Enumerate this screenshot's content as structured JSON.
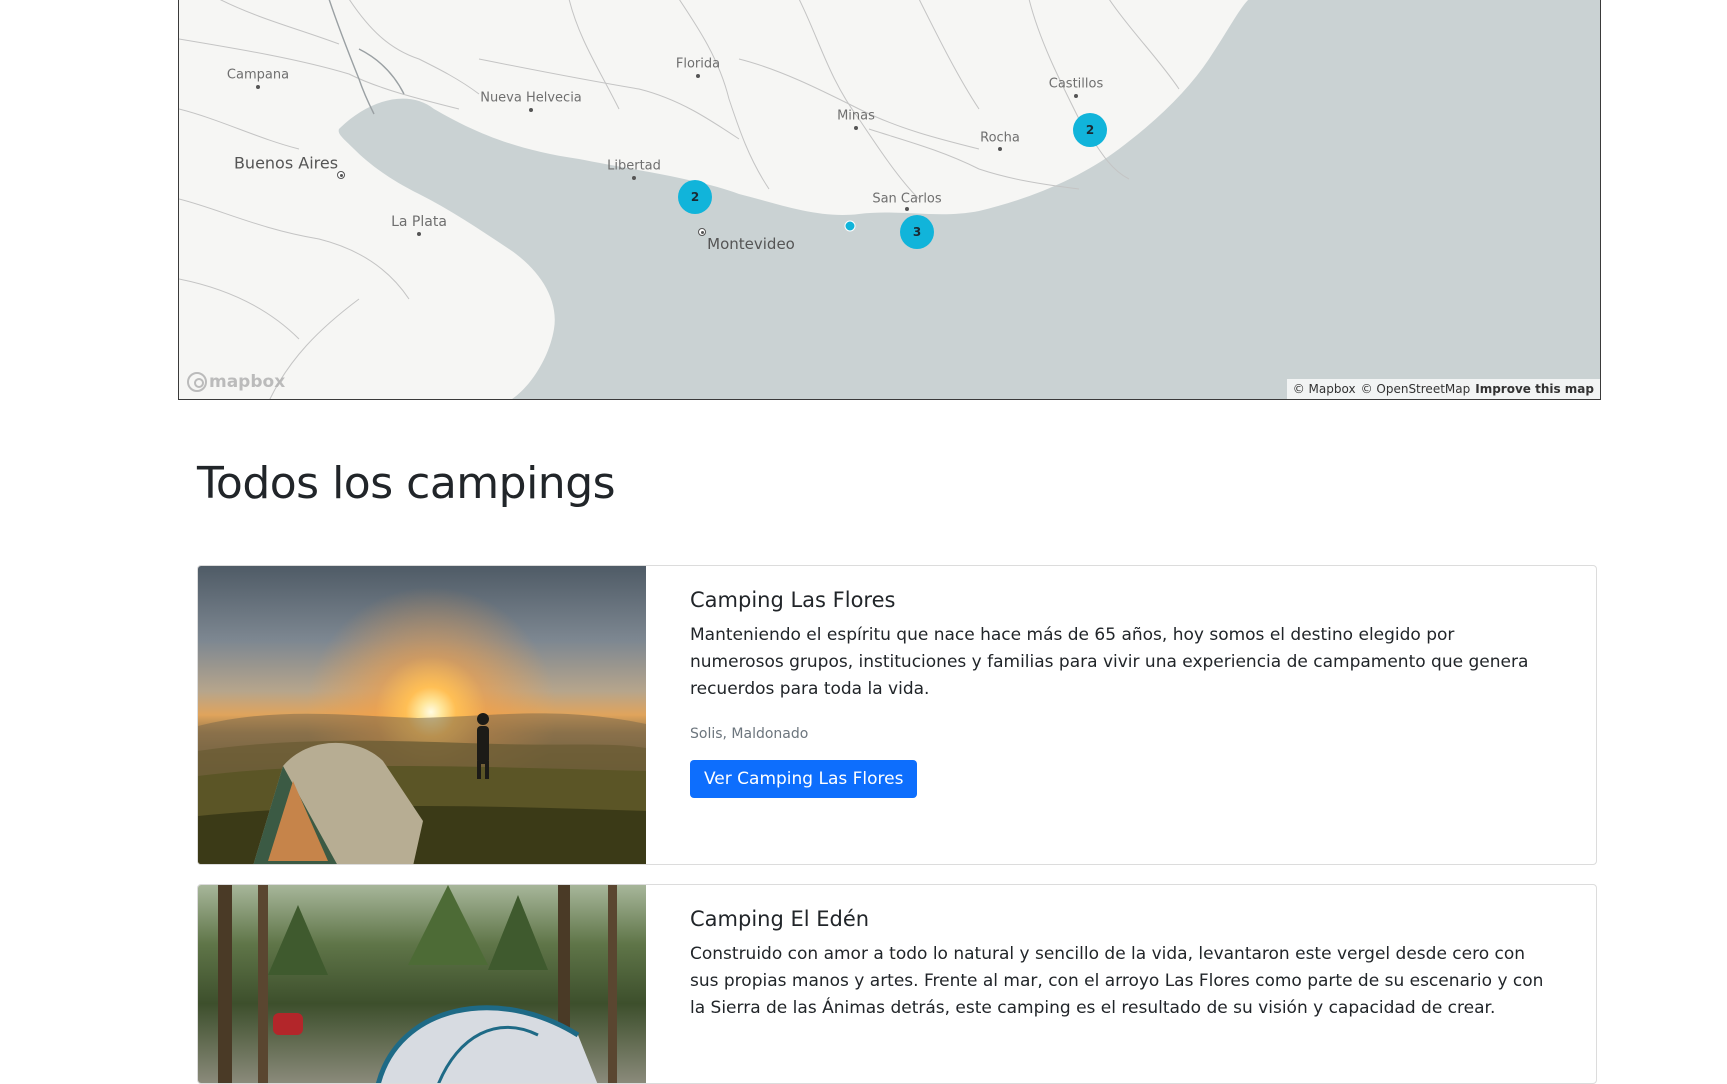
{
  "map": {
    "places": [
      {
        "name": "Campana",
        "dot": "dot",
        "big": false
      },
      {
        "name": "Nueva Helvecia",
        "dot": "dot",
        "big": false
      },
      {
        "name": "Florida",
        "dot": "dot",
        "big": false
      },
      {
        "name": "Minas",
        "dot": "dot",
        "big": false
      },
      {
        "name": "Castillos",
        "dot": "dot",
        "big": false
      },
      {
        "name": "Rocha",
        "dot": "dot",
        "big": false
      },
      {
        "name": "Libertad",
        "dot": "dot",
        "big": false
      },
      {
        "name": "San Carlos",
        "dot": "dot",
        "big": false
      },
      {
        "name": "Buenos Aires",
        "dot": "ring",
        "big": true
      },
      {
        "name": "La Plata",
        "dot": "dot",
        "big": false
      },
      {
        "name": "Montevideo",
        "dot": "ring",
        "big": true
      }
    ],
    "clusters": [
      {
        "count": "2"
      },
      {
        "count": "3"
      },
      {
        "count": "2"
      }
    ],
    "cluster_color": "#11b4da",
    "logo_text": "mapbox",
    "attribution": {
      "mapbox": "© Mapbox",
      "osm": "© OpenStreetMap",
      "improve": "Improve this map"
    }
  },
  "page_title": "Todos los campings",
  "campgrounds": [
    {
      "title": "Camping Las Flores",
      "description": "Manteniendo el espíritu que nace hace más de 65 años, hoy somos el destino elegido por numerosos grupos, instituciones y familias para vivir una experiencia de campamento que genera recuerdos para toda la vida.",
      "location": "Solis, Maldonado",
      "button": "Ver Camping Las Flores"
    },
    {
      "title": "Camping El Edén",
      "description": "Construido con amor a todo lo natural y sencillo de la vida, levantaron este vergel desde cero con sus propias manos y artes. Frente al mar, con el arroyo Las Flores como parte de su escenario y con la Sierra de las Ánimas detrás, este camping es el resultado de su visión y capacidad de crear."
    }
  ],
  "colors": {
    "primary_button": "#0d6efd",
    "water": "#cad2d3",
    "land": "#f6f6f4"
  }
}
